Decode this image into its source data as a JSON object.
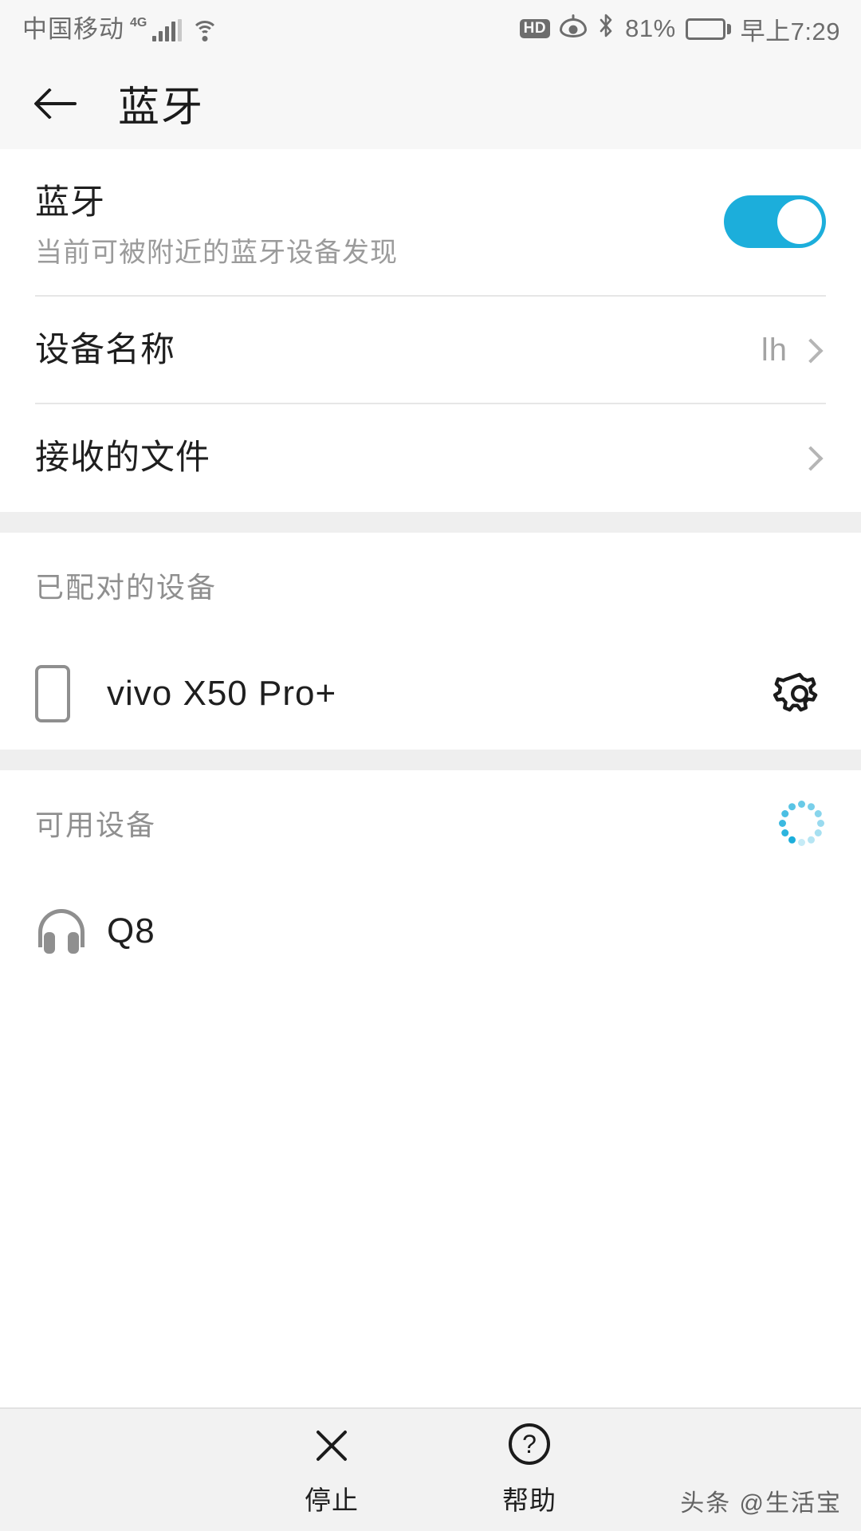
{
  "statusbar": {
    "carrier": "中国移动",
    "network_badge": "4G",
    "wifi_icon": "wifi-icon",
    "hd_badge": "HD",
    "eye_comfort_icon": "eye-comfort-icon",
    "bluetooth_icon": "⌬",
    "battery_percent": "81%",
    "clock": "早上7:29"
  },
  "appbar": {
    "back_icon": "back-arrow-icon",
    "title": "蓝牙"
  },
  "bluetooth": {
    "title": "蓝牙",
    "subtitle": "当前可被附近的蓝牙设备发现",
    "toggle_on": true,
    "toggle_color": "#1CAEDB"
  },
  "rows": {
    "device_name": {
      "label": "设备名称",
      "value": "lh"
    },
    "received_files": {
      "label": "接收的文件",
      "value": ""
    }
  },
  "paired": {
    "section_label": "已配对的设备",
    "devices": [
      {
        "name": "vivo X50 Pro+",
        "icon": "phone-icon",
        "action_icon": "gear-icon"
      }
    ]
  },
  "available": {
    "section_label": "可用设备",
    "scanning": true,
    "spinner_color": "#1CAEDB",
    "devices": [
      {
        "name": "Q8",
        "icon": "headphone-icon"
      }
    ]
  },
  "bottombar": {
    "stop": {
      "label": "停止",
      "icon": "close-x-icon"
    },
    "help": {
      "label": "帮助",
      "icon": "question-mark-icon",
      "glyph": "?"
    }
  },
  "watermark": "头条 @生活宝"
}
